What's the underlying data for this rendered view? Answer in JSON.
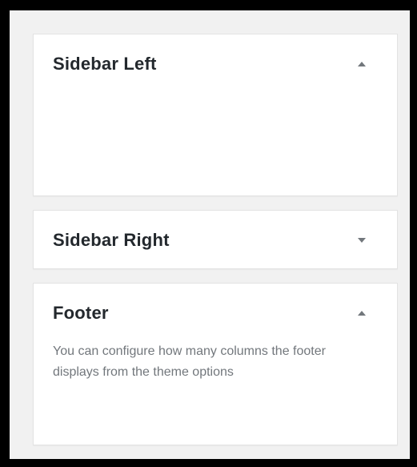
{
  "widget_areas": [
    {
      "title": "Sidebar Left",
      "expanded": true,
      "toggle_icon": "arrow-up-icon",
      "description": ""
    },
    {
      "title": "Sidebar Right",
      "expanded": false,
      "toggle_icon": "arrow-down-icon",
      "description": ""
    },
    {
      "title": "Footer",
      "expanded": true,
      "toggle_icon": "arrow-up-icon",
      "description": "You can configure how many columns the footer displays from the theme options"
    }
  ],
  "colors": {
    "background": "#f1f1f1",
    "panel": "#ffffff",
    "title": "#23282d",
    "muted": "#72777c"
  }
}
